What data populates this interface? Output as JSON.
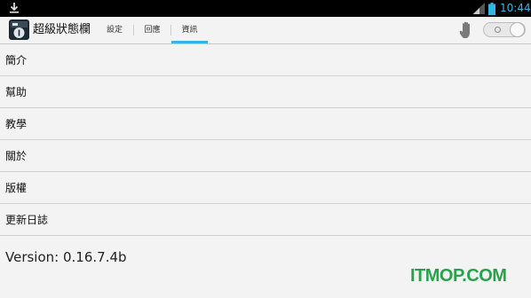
{
  "status_bar": {
    "time": "10:44",
    "icons": [
      "download-icon",
      "signal-icon",
      "battery-icon"
    ]
  },
  "action_bar": {
    "app_title": "超級狀態欄",
    "tabs": [
      {
        "label": "設定",
        "active": false
      },
      {
        "label": "回應",
        "active": false
      },
      {
        "label": "資訊",
        "active": true
      }
    ],
    "toggle_on": false,
    "icons": [
      "app-icon",
      "hand-icon"
    ]
  },
  "menu": {
    "items": [
      {
        "label": "簡介"
      },
      {
        "label": "幫助"
      },
      {
        "label": "教學"
      },
      {
        "label": "關於"
      },
      {
        "label": "版權"
      },
      {
        "label": "更新日誌"
      }
    ]
  },
  "version_text": "Version: 0.16.7.4b",
  "watermark": "ITMOP.COM",
  "colors": {
    "accent": "#33b5e5",
    "background": "#f3f3f3",
    "watermark": "#27a34a"
  }
}
